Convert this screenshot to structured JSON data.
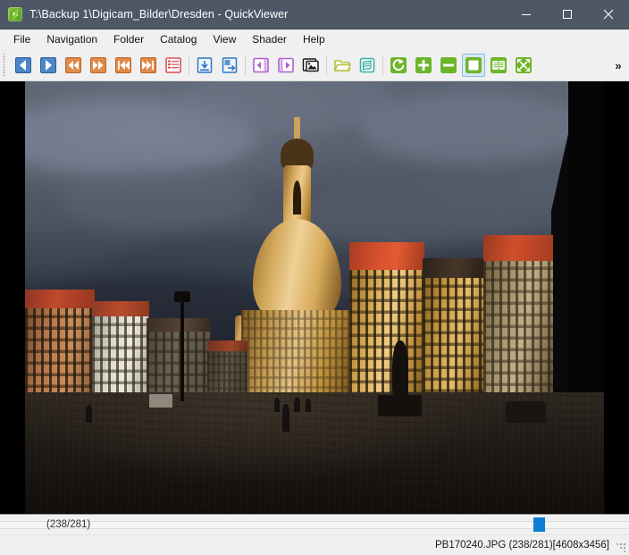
{
  "window": {
    "title": "T:\\Backup 1\\Digicam_Bilder\\Dresden - QuickViewer",
    "app_icon": "quickviewer-green-circle-icon",
    "titlebar_color": "#4d5766",
    "controls": {
      "minimize": "minimize-icon",
      "maximize": "maximize-icon",
      "close": "close-icon"
    }
  },
  "menubar": {
    "items": [
      {
        "label": "File"
      },
      {
        "label": "Navigation"
      },
      {
        "label": "Folder"
      },
      {
        "label": "Catalog"
      },
      {
        "label": "View"
      },
      {
        "label": "Shader"
      },
      {
        "label": "Help"
      }
    ]
  },
  "toolbar": {
    "overflow_label": "»",
    "groups": [
      {
        "buttons": [
          {
            "icon": "prev-page-icon",
            "name": "prev-page-button",
            "color": "#4a86c8",
            "active": false
          },
          {
            "icon": "next-page-icon",
            "name": "next-page-button",
            "color": "#4a86c8",
            "active": false
          },
          {
            "icon": "fast-rewind-icon",
            "name": "fast-rewind-button",
            "color": "#e08a4a",
            "active": false
          },
          {
            "icon": "fast-forward-icon",
            "name": "fast-forward-button",
            "color": "#e08a4a",
            "active": false
          },
          {
            "icon": "skip-first-icon",
            "name": "first-page-button",
            "color": "#e08a4a",
            "active": false
          },
          {
            "icon": "skip-last-icon",
            "name": "last-page-button",
            "color": "#e08a4a",
            "active": false
          },
          {
            "icon": "playlist-icon",
            "name": "catalog-list-button",
            "color": "#d9534f",
            "active": false
          }
        ]
      },
      {
        "buttons": [
          {
            "icon": "open-file-icon",
            "name": "open-file-button",
            "color": "#2f74c0",
            "active": false
          },
          {
            "icon": "export-file-icon",
            "name": "export-file-button",
            "color": "#2f74c0",
            "active": false
          }
        ]
      },
      {
        "buttons": [
          {
            "icon": "page-left-icon",
            "name": "page-left-button",
            "color": "#b05ed0",
            "active": false
          },
          {
            "icon": "page-right-icon",
            "name": "page-right-button",
            "color": "#b05ed0",
            "active": false
          },
          {
            "icon": "slideshow-icon",
            "name": "slideshow-button",
            "color": "#1a1a1a",
            "active": false
          }
        ]
      },
      {
        "buttons": [
          {
            "icon": "folder-icon",
            "name": "open-folder-button",
            "color": "#b8bf3a",
            "active": false
          },
          {
            "icon": "book-icon",
            "name": "open-archive-button",
            "color": "#3aada8",
            "active": false
          }
        ]
      },
      {
        "buttons": [
          {
            "icon": "rotate-icon",
            "name": "rotate-button",
            "color": "#6eb52a",
            "active": false
          },
          {
            "icon": "zoom-in-icon",
            "name": "zoom-in-button",
            "color": "#6eb52a",
            "active": false
          },
          {
            "icon": "zoom-out-icon",
            "name": "zoom-out-button",
            "color": "#6eb52a",
            "active": false
          },
          {
            "icon": "fit-window-icon",
            "name": "fit-window-button",
            "color": "#6eb52a",
            "active": true
          },
          {
            "icon": "dual-page-icon",
            "name": "dual-page-button",
            "color": "#6eb52a",
            "active": false
          },
          {
            "icon": "fullscreen-icon",
            "name": "fullscreen-button",
            "color": "#6eb52a",
            "active": false
          }
        ]
      }
    ]
  },
  "slider": {
    "position_label": "(238/281)",
    "value": 238,
    "max": 281,
    "handle_color": "#0b7fd4"
  },
  "statusbar": {
    "text": "PB170240.JPG (238/281)[4608x3456]",
    "filename": "PB170240.JPG",
    "index": "(238/281)",
    "dimensions": "[4608x3456]"
  },
  "viewer": {
    "background": "#000000",
    "image_description": "Dresden Neumarkt square with the Frauenkirche dome lit by golden evening sun under dark storm clouds"
  }
}
